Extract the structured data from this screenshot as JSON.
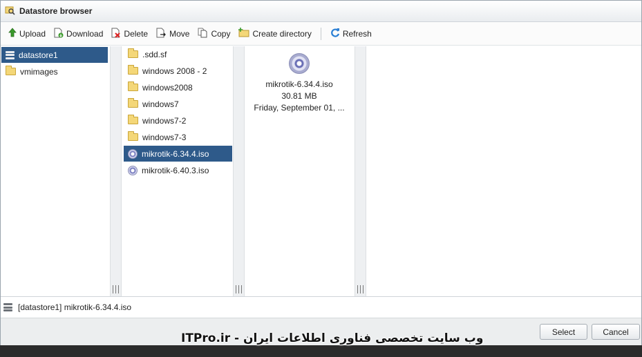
{
  "window": {
    "title": "Datastore browser"
  },
  "toolbar": {
    "upload": "Upload",
    "download": "Download",
    "delete": "Delete",
    "move": "Move",
    "copy": "Copy",
    "create_directory": "Create directory",
    "refresh": "Refresh"
  },
  "datastores": [
    {
      "label": "datastore1",
      "icon": "datastore-icon",
      "selected": true
    },
    {
      "label": "vmimages",
      "icon": "folder-icon",
      "selected": false
    }
  ],
  "files": [
    {
      "label": ".sdd.sf",
      "icon": "folder-icon"
    },
    {
      "label": "windows 2008 - 2",
      "icon": "folder-icon"
    },
    {
      "label": "windows2008",
      "icon": "folder-icon"
    },
    {
      "label": "windows7",
      "icon": "folder-icon"
    },
    {
      "label": "windows7-2",
      "icon": "folder-icon"
    },
    {
      "label": "windows7-3",
      "icon": "folder-icon"
    },
    {
      "label": "mikrotik-6.34.4.iso",
      "icon": "disc-image-icon",
      "selected": true
    },
    {
      "label": "mikrotik-6.40.3.iso",
      "icon": "disc-image-icon"
    }
  ],
  "preview": {
    "name": "mikrotik-6.34.4.iso",
    "size": "30.81 MB",
    "date": "Friday, September 01, ..."
  },
  "status": {
    "path": "[datastore1] mikrotik-6.34.4.iso"
  },
  "buttons": {
    "select": "Select",
    "cancel": "Cancel"
  },
  "watermark": {
    "text": "ITPro.ir - وب سایت تخصصی فناوری اطلاعات ایران"
  },
  "colors": {
    "selection": "#2e5a8a",
    "folder": "#f4d778",
    "refresh": "#2a7fd4",
    "upload": "#3a9a2a"
  }
}
